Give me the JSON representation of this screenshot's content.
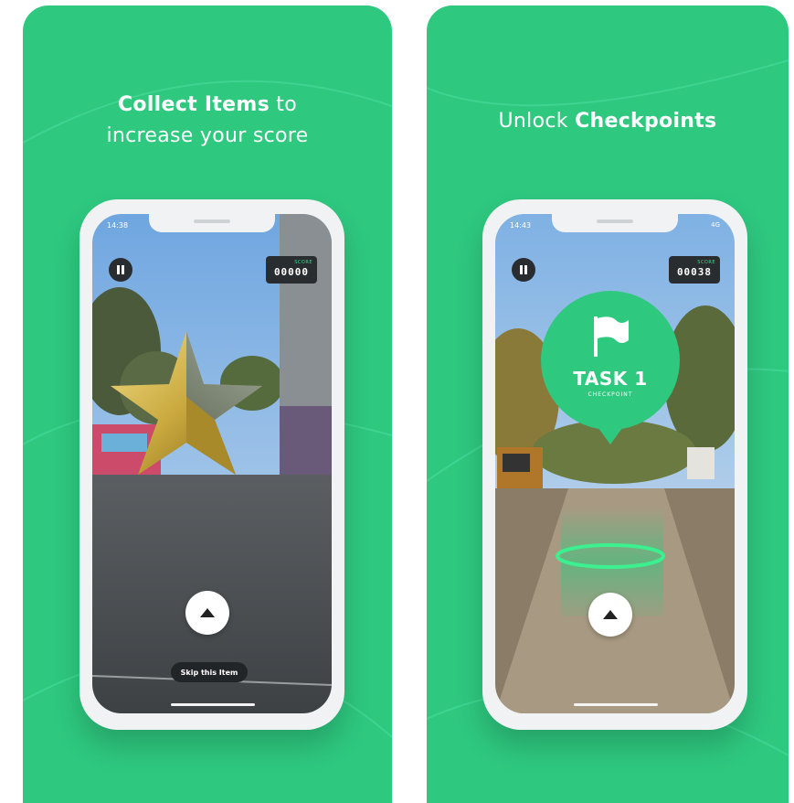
{
  "left_card": {
    "headline_bold": "Collect Items",
    "headline_rest": " to",
    "headline_line2": "increase your score",
    "phone": {
      "status_time": "14:38",
      "score_label": "SCORE",
      "score_value": "00000",
      "skip_label": "Skip this Item"
    }
  },
  "right_card": {
    "headline_plain": "Unlock ",
    "headline_bold": "Checkpoints",
    "phone": {
      "status_time": "14:43",
      "status_right": "4G",
      "score_label": "SCORE",
      "score_value": "00038",
      "checkpoint_title": "TASK 1",
      "checkpoint_subtitle": "CHECKPOINT"
    }
  },
  "colors": {
    "brand_green": "#2ec87f",
    "dark_ui": "#2a2d30",
    "gold": "#c9a93e"
  },
  "icons": [
    "pause-icon",
    "chevron-up-icon",
    "flag-icon",
    "star-item"
  ]
}
